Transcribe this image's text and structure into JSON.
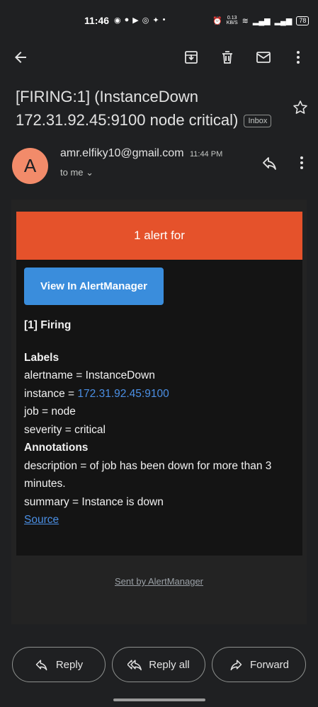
{
  "status_bar": {
    "time": "11:46",
    "left_icons": [
      "whatsapp-icon",
      "facebook-icon",
      "youtube-icon",
      "opera-icon",
      "twitter-icon",
      "dot-icon"
    ],
    "net_speed_value": "0.13",
    "net_speed_unit": "KB/S",
    "battery": "78"
  },
  "toolbar": {
    "icons": [
      "back-arrow-icon",
      "archive-icon",
      "delete-icon",
      "mark-unread-icon",
      "more-vert-icon"
    ]
  },
  "email": {
    "subject": "[FIRING:1]  (InstanceDown 172.31.92.45:9100 node critical)",
    "label": "Inbox",
    "avatar_letter": "A",
    "avatar_color": "#f28b6a",
    "sender": "amr.elfiky10@gmail.com",
    "time": "11:44 PM",
    "recipient": "to me"
  },
  "alert": {
    "header": "1 alert for",
    "header_color": "#e5522b",
    "button_label": "View In AlertManager",
    "button_color": "#3a8ddc",
    "firing_title": "[1] Firing",
    "labels_title": "Labels",
    "alertname": "alertname = InstanceDown",
    "instance_prefix": "instance = ",
    "instance_link": "172.31.92.45:9100",
    "job": "job = node",
    "severity": "severity = critical",
    "annotations_title": "Annotations",
    "description": "description = of job has been down for more than 3 minutes.",
    "summary": "summary = Instance is down",
    "source_link": "Source",
    "sent_by": "Sent by AlertManager"
  },
  "actions": {
    "reply": "Reply",
    "reply_all": "Reply all",
    "forward": "Forward"
  }
}
